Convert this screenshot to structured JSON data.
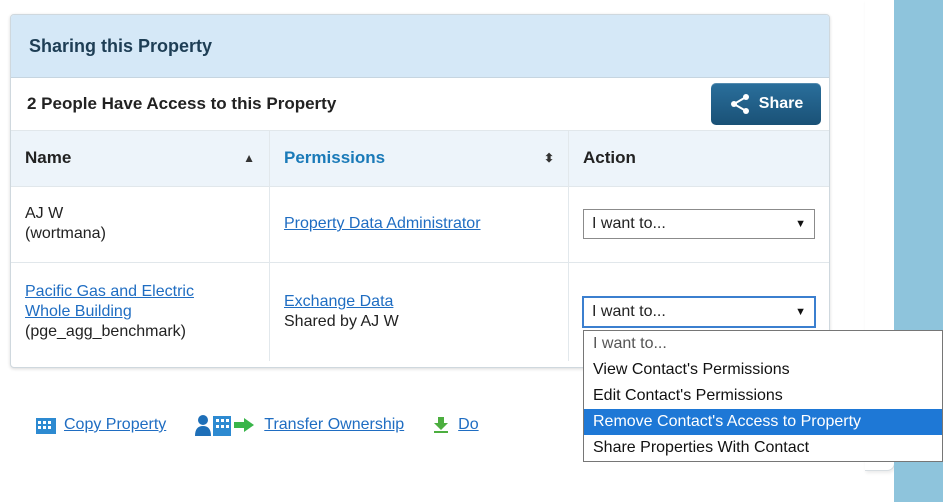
{
  "panel": {
    "title": "Sharing this Property",
    "subheader": "2 People Have Access to this Property",
    "share_label": "Share"
  },
  "table": {
    "columns": {
      "name": "Name",
      "permissions": "Permissions",
      "action": "Action"
    },
    "rows": [
      {
        "name": "AJ W",
        "username": "(wortmana)",
        "permission": "Property Data Administrator",
        "shared_by": "",
        "action_value": "I want to..."
      },
      {
        "name_line1": "Pacific Gas and Electric",
        "name_line2": "Whole Building",
        "username": "(pge_agg_benchmark)",
        "permission": "Exchange Data",
        "shared_by": "Shared by AJ W",
        "action_value": "I want to..."
      }
    ]
  },
  "dropdown": {
    "options": [
      "I want to...",
      "View Contact's Permissions",
      "Edit Contact's Permissions",
      "Remove Contact's Access to Property",
      "Share Properties With Contact"
    ],
    "highlighted": "Remove Contact's Access to Property"
  },
  "bottom_actions": {
    "copy": "Copy Property",
    "transfer": "Transfer Ownership",
    "truncated": "Do"
  },
  "colors": {
    "header_bg": "#d5e8f7",
    "link": "#1f6dc2",
    "share_btn": "#1f5f88",
    "highlight": "#1e78d6",
    "right_strip": "#8ec4dc"
  }
}
